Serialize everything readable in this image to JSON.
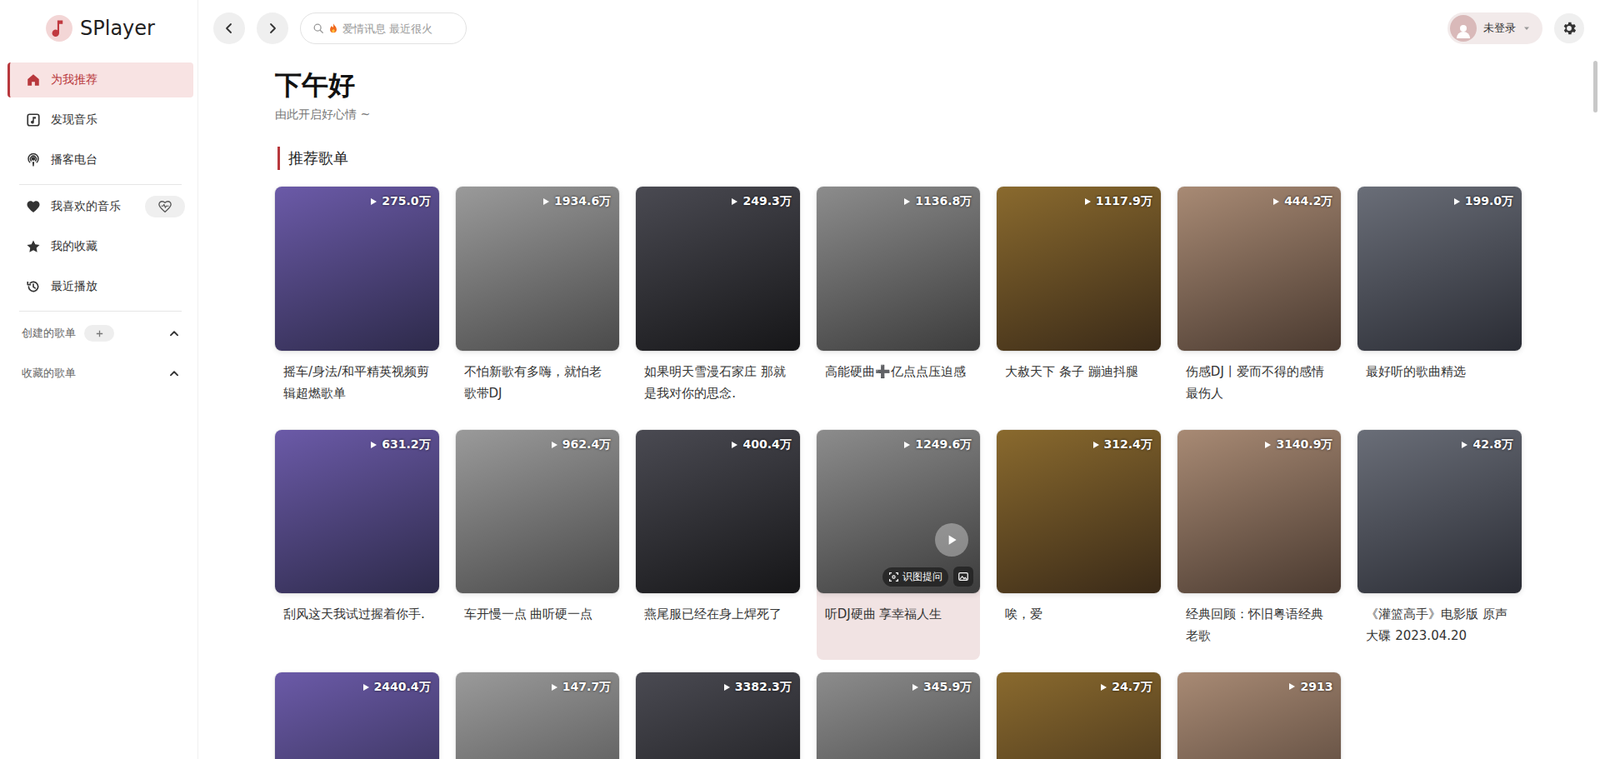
{
  "app": {
    "name": "SPlayer"
  },
  "sidebar": {
    "nav": [
      {
        "label": "为我推荐",
        "selected": true
      },
      {
        "label": "发现音乐",
        "selected": false
      },
      {
        "label": "播客电台",
        "selected": false
      }
    ],
    "library": [
      {
        "label": "我喜欢的音乐",
        "selected": false
      },
      {
        "label": "我的收藏",
        "selected": false
      },
      {
        "label": "最近播放",
        "selected": false
      }
    ],
    "playlist_groups": [
      {
        "label": "创建的歌单",
        "expanded": true,
        "can_add": true
      },
      {
        "label": "收藏的歌单",
        "expanded": true,
        "can_add": false
      }
    ]
  },
  "topbar": {
    "search": {
      "placeholder": "爱情讯息 最近很火"
    },
    "user": {
      "label": "未登录"
    }
  },
  "greeting": {
    "title": "下午好",
    "subtitle": "由此开启好心情 ~"
  },
  "section": {
    "title": "推荐歌单"
  },
  "image_tool": {
    "label": "识图提问"
  },
  "playlists": [
    {
      "title": "摇车/身法/和平精英视频剪辑超燃歌单",
      "plays": "275.0万",
      "hovered": false
    },
    {
      "title": "不怕新歌有多嗨，就怕老歌带DJ",
      "plays": "1934.6万",
      "hovered": false
    },
    {
      "title": "如果明天雪漫石家庄 那就是我对你的思念.",
      "plays": "249.3万",
      "hovered": false
    },
    {
      "title": "高能硬曲➕亿点点压迫感",
      "plays": "1136.8万",
      "hovered": false
    },
    {
      "title": "大赦天下 条子 蹦迪抖腿",
      "plays": "1117.9万",
      "hovered": false
    },
    {
      "title": "伤感DJ丨爱而不得的感情最伤人",
      "plays": "444.2万",
      "hovered": false
    },
    {
      "title": "最好听的歌曲精选",
      "plays": "199.0万",
      "hovered": false
    },
    {
      "title": "刮风这天我试过握着你手.",
      "plays": "631.2万",
      "hovered": false
    },
    {
      "title": "车开慢一点 曲听硬一点",
      "plays": "962.4万",
      "hovered": false
    },
    {
      "title": "燕尾服已经在身上焊死了",
      "plays": "400.4万",
      "hovered": false
    },
    {
      "title": "听DJ硬曲 享幸福人生",
      "plays": "1249.6万",
      "hovered": true
    },
    {
      "title": "唉，爱",
      "plays": "312.4万",
      "hovered": false
    },
    {
      "title": "经典回顾：怀旧粤语经典老歌",
      "plays": "3140.9万",
      "hovered": false
    },
    {
      "title": "《灌篮高手》电影版 原声大碟 2023.04.20",
      "plays": "42.8万",
      "hovered": false
    },
    {
      "title": "",
      "plays": "2440.4万",
      "hovered": false
    },
    {
      "title": "",
      "plays": "147.7万",
      "hovered": false
    },
    {
      "title": "",
      "plays": "3382.3万",
      "hovered": false
    },
    {
      "title": "",
      "plays": "345.9万",
      "hovered": false
    },
    {
      "title": "",
      "plays": "24.7万",
      "hovered": false
    },
    {
      "title": "",
      "plays": "2913",
      "hovered": false
    }
  ]
}
